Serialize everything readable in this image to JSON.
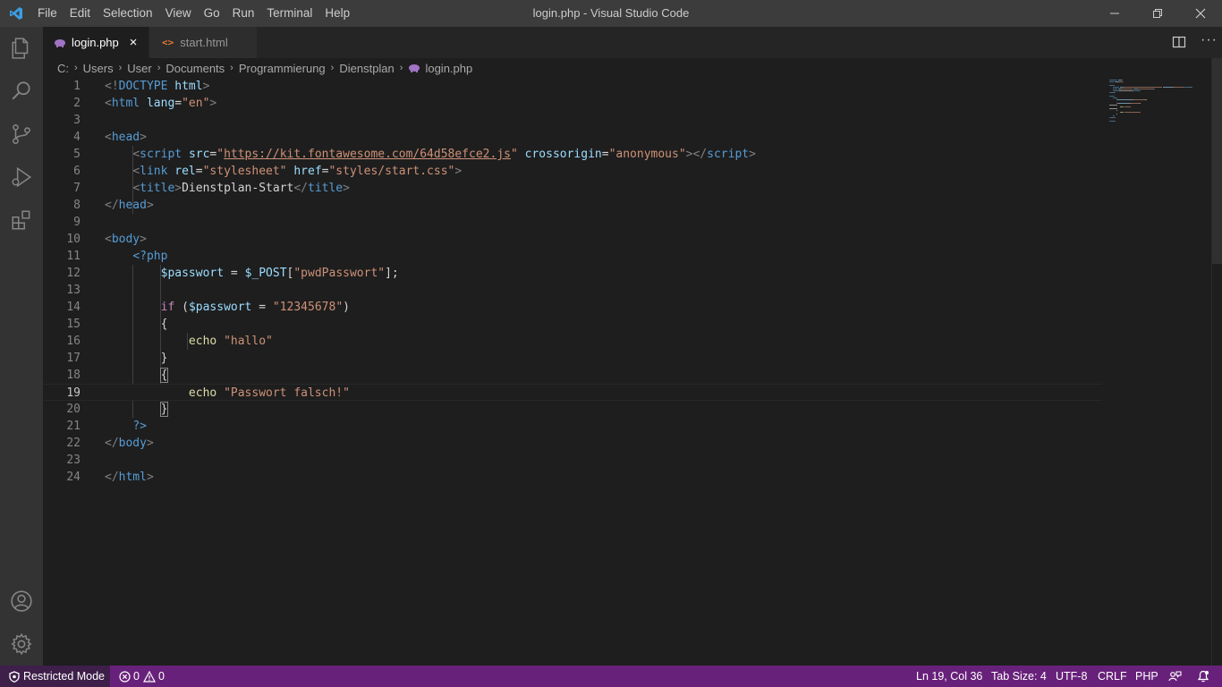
{
  "window": {
    "title": "login.php - Visual Studio Code",
    "menu": [
      "File",
      "Edit",
      "Selection",
      "View",
      "Go",
      "Run",
      "Terminal",
      "Help"
    ]
  },
  "activitybar": {
    "icons": [
      "explorer-icon",
      "search-icon",
      "source-control-icon",
      "run-debug-icon",
      "extensions-icon",
      "accounts-icon",
      "manage-gear-icon"
    ]
  },
  "tabs": [
    {
      "label": "login.php",
      "active": true,
      "icon": "php-elephant-icon"
    },
    {
      "label": "start.html",
      "active": false,
      "icon": "html-icon"
    }
  ],
  "breadcrumb": [
    "C:",
    "Users",
    "User",
    "Documents",
    "Programmierung",
    "Dienstplan",
    "login.php"
  ],
  "editor": {
    "current_line": 19,
    "line_numbers": [
      "1",
      "2",
      "3",
      "4",
      "5",
      "6",
      "7",
      "8",
      "9",
      "10",
      "11",
      "12",
      "13",
      "14",
      "15",
      "16",
      "17",
      "18",
      "19",
      "20",
      "21",
      "22",
      "23",
      "24"
    ],
    "lines": [
      [
        [
          "tag",
          "<!"
        ],
        [
          "name",
          "DOCTYPE"
        ],
        [
          "txt",
          " "
        ],
        [
          "attr",
          "html"
        ],
        [
          "tag",
          ">"
        ]
      ],
      [
        [
          "tag",
          "<"
        ],
        [
          "name",
          "html"
        ],
        [
          "txt",
          " "
        ],
        [
          "attr",
          "lang"
        ],
        [
          "txt",
          "="
        ],
        [
          "str",
          "\"en\""
        ],
        [
          "tag",
          ">"
        ]
      ],
      [],
      [
        [
          "tag",
          "<"
        ],
        [
          "name",
          "head"
        ],
        [
          "tag",
          ">"
        ]
      ],
      [
        [
          "txt",
          "    "
        ],
        [
          "tag",
          "<"
        ],
        [
          "name",
          "script"
        ],
        [
          "txt",
          " "
        ],
        [
          "attr",
          "src"
        ],
        [
          "txt",
          "="
        ],
        [
          "str",
          "\""
        ],
        [
          "url",
          "https://kit.fontawesome.com/64d58efce2.js"
        ],
        [
          "str",
          "\""
        ],
        [
          "txt",
          " "
        ],
        [
          "attr",
          "crossorigin"
        ],
        [
          "txt",
          "="
        ],
        [
          "str",
          "\"anonymous\""
        ],
        [
          "tag",
          "></"
        ],
        [
          "name",
          "script"
        ],
        [
          "tag",
          ">"
        ]
      ],
      [
        [
          "txt",
          "    "
        ],
        [
          "tag",
          "<"
        ],
        [
          "name",
          "link"
        ],
        [
          "txt",
          " "
        ],
        [
          "attr",
          "rel"
        ],
        [
          "txt",
          "="
        ],
        [
          "str",
          "\"stylesheet\""
        ],
        [
          "txt",
          " "
        ],
        [
          "attr",
          "href"
        ],
        [
          "txt",
          "="
        ],
        [
          "str",
          "\"styles/start.css\""
        ],
        [
          "tag",
          ">"
        ]
      ],
      [
        [
          "txt",
          "    "
        ],
        [
          "tag",
          "<"
        ],
        [
          "name",
          "title"
        ],
        [
          "tag",
          ">"
        ],
        [
          "txt",
          "Dienstplan-Start"
        ],
        [
          "tag",
          "</"
        ],
        [
          "name",
          "title"
        ],
        [
          "tag",
          ">"
        ]
      ],
      [
        [
          "tag",
          "</"
        ],
        [
          "name",
          "head"
        ],
        [
          "tag",
          ">"
        ]
      ],
      [],
      [
        [
          "tag",
          "<"
        ],
        [
          "name",
          "body"
        ],
        [
          "tag",
          ">"
        ]
      ],
      [
        [
          "txt",
          "    "
        ],
        [
          "php",
          "<?php"
        ]
      ],
      [
        [
          "txt",
          "        "
        ],
        [
          "var",
          "$passwort"
        ],
        [
          "txt",
          " = "
        ],
        [
          "var",
          "$_POST"
        ],
        [
          "txt",
          "["
        ],
        [
          "str",
          "\"pwdPasswort\""
        ],
        [
          "txt",
          "];"
        ]
      ],
      [],
      [
        [
          "txt",
          "        "
        ],
        [
          "kw",
          "if"
        ],
        [
          "txt",
          " ("
        ],
        [
          "var",
          "$passwort"
        ],
        [
          "txt",
          " = "
        ],
        [
          "str",
          "\"12345678\""
        ],
        [
          "txt",
          ")"
        ]
      ],
      [
        [
          "txt",
          "        {"
        ]
      ],
      [
        [
          "txt",
          "            "
        ],
        [
          "fn",
          "echo"
        ],
        [
          "txt",
          " "
        ],
        [
          "str",
          "\"hallo\""
        ]
      ],
      [
        [
          "txt",
          "        }"
        ]
      ],
      [
        [
          "txt",
          "        "
        ],
        [
          "bracket",
          "{"
        ]
      ],
      [
        [
          "txt",
          "            "
        ],
        [
          "fn",
          "echo"
        ],
        [
          "txt",
          " "
        ],
        [
          "str",
          "\"Passwort falsch!\""
        ]
      ],
      [
        [
          "txt",
          "        "
        ],
        [
          "bracket",
          "}"
        ]
      ],
      [
        [
          "txt",
          "    "
        ],
        [
          "php",
          "?>"
        ]
      ],
      [
        [
          "tag",
          "</"
        ],
        [
          "name",
          "body"
        ],
        [
          "tag",
          ">"
        ]
      ],
      [],
      [
        [
          "tag",
          "</"
        ],
        [
          "name",
          "html"
        ],
        [
          "tag",
          ">"
        ]
      ]
    ]
  },
  "statusbar": {
    "restricted_mode": "Restricted Mode",
    "errors": "0",
    "warnings": "0",
    "cursor": "Ln 19, Col 36",
    "tab_size": "Tab Size: 4",
    "encoding": "UTF-8",
    "eol": "CRLF",
    "language": "PHP"
  },
  "colors": {
    "statusbar": "#68217a",
    "titlebar": "#3c3c3c",
    "activitybar": "#333333",
    "editor": "#1e1e1e"
  }
}
